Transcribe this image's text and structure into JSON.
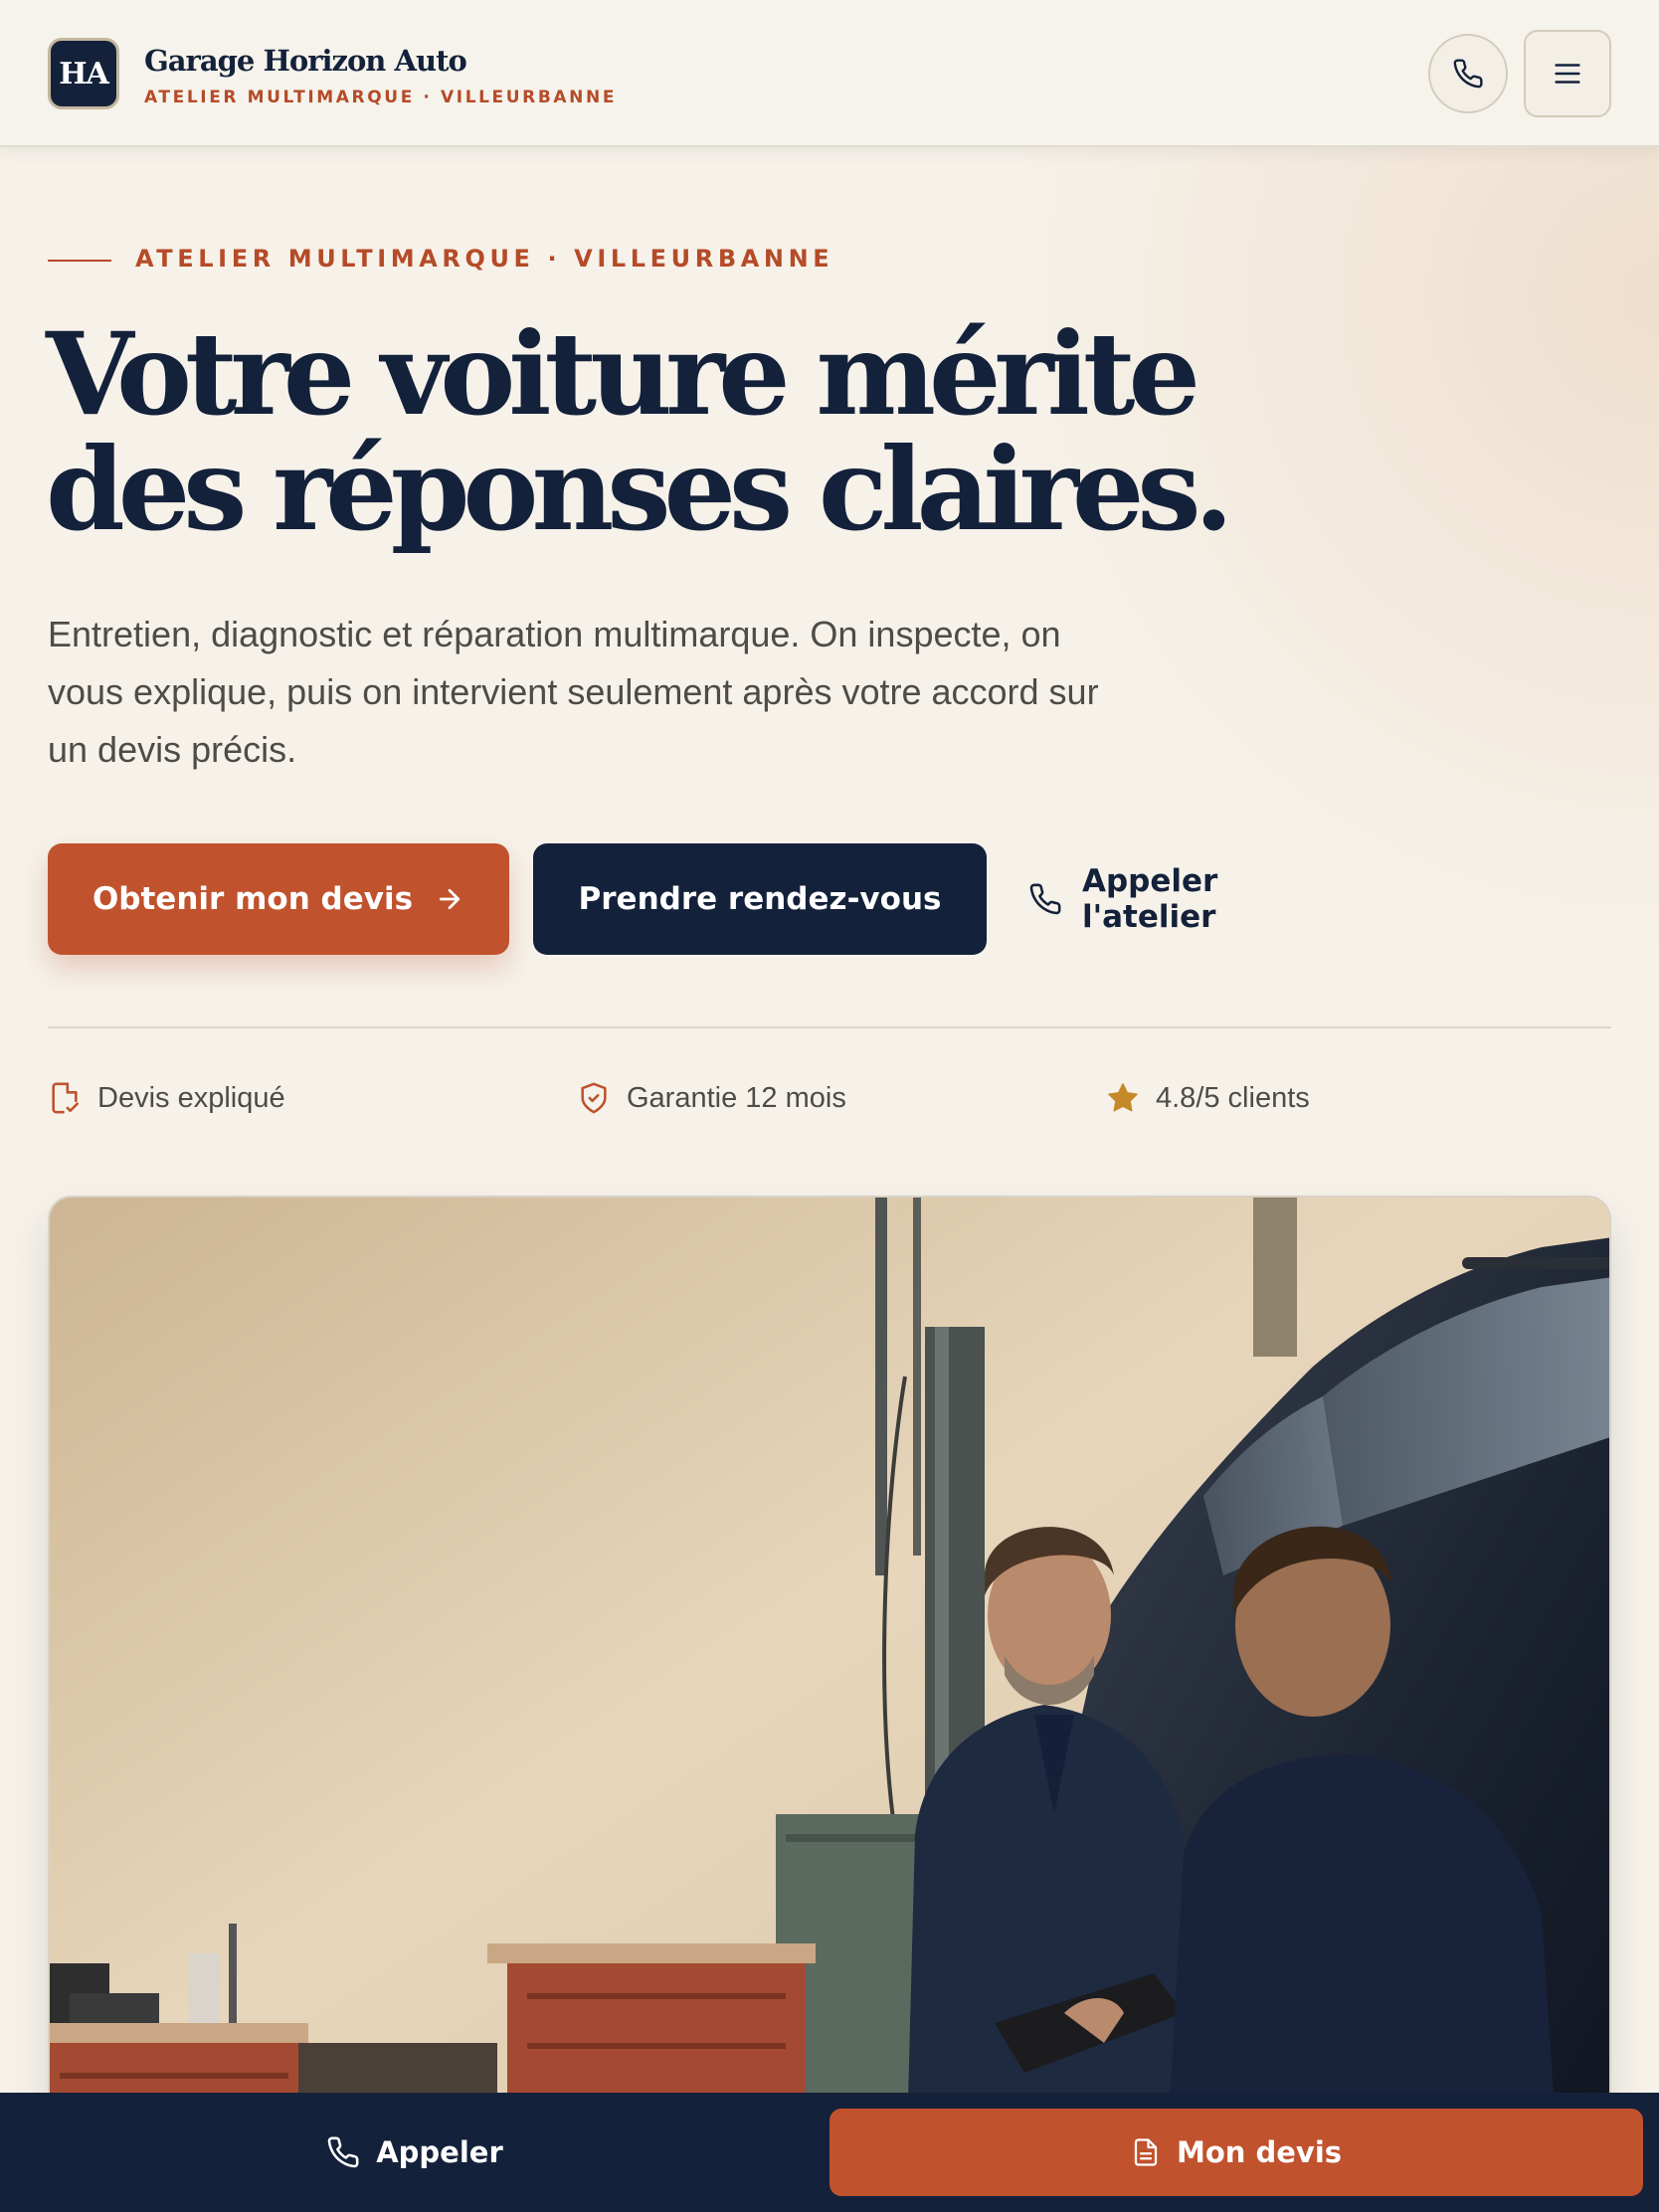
{
  "header": {
    "logo_initials": "HA",
    "brand_name": "Garage Horizon Auto",
    "brand_tagline": "ATELIER MULTIMARQUE · VILLEURBANNE",
    "phone_icon": "phone-icon",
    "menu_icon": "hamburger-menu-icon"
  },
  "hero": {
    "eyebrow": "ATELIER MULTIMARQUE · VILLEURBANNE",
    "headline_line1": "Votre voiture mérite",
    "headline_line2": "des réponses claires.",
    "intro_line1": "Entretien, diagnostic et réparation multimarque. On inspecte, on",
    "intro_line2": "vous explique, puis on intervient seulement après votre accord sur",
    "intro_line3": "un devis précis.",
    "cta_quote": "Obtenir mon devis",
    "cta_appointment": "Prendre rendez-vous",
    "cta_call": "Appeler l'atelier"
  },
  "trust": {
    "item1": "Devis expliqué",
    "item2": "Garantie 12 mois",
    "item3": "4.8/5 clients",
    "icons": [
      "document-check-icon",
      "shield-check-icon",
      "star-icon"
    ]
  },
  "bottom_bar": {
    "call_label": "Appeler",
    "quote_label": "Mon devis"
  },
  "colors": {
    "navy": "#14213a",
    "accent": "#c0522d",
    "accent_text": "#b54b28",
    "background": "#f6f2ea",
    "star": "#c48a2a"
  }
}
